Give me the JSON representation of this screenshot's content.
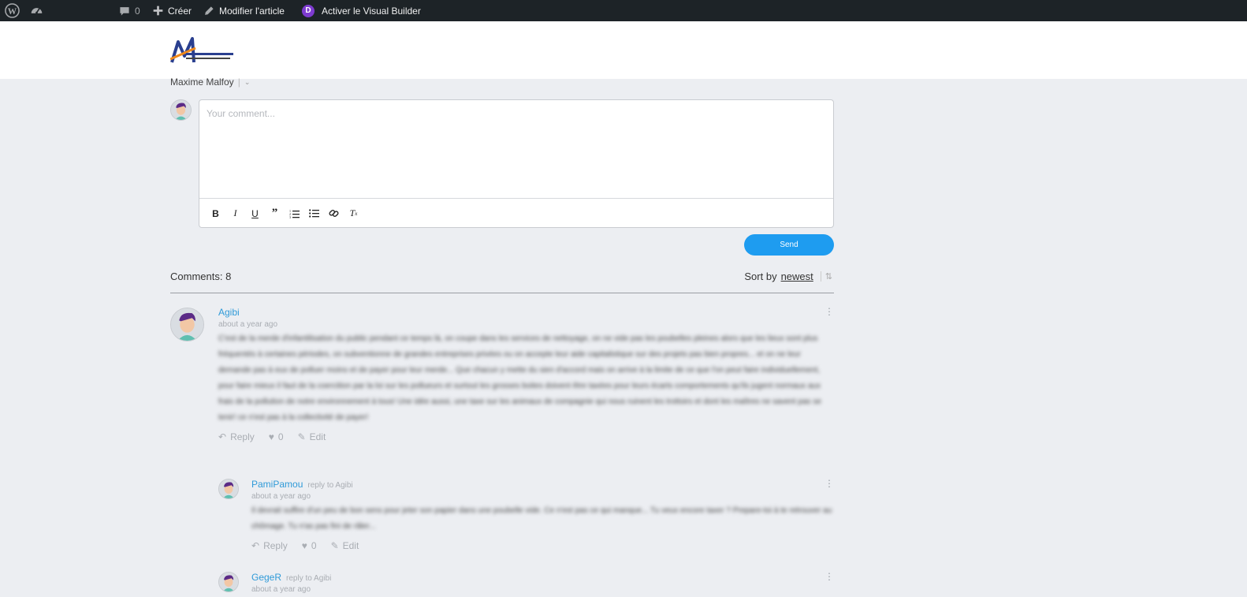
{
  "adminbar": {
    "wp_logo": "wordpress-icon",
    "dashboard_icon": "dashboard-icon",
    "comments_icon": "comment-bubble-icon",
    "comments_count": "0",
    "create_label": "Créer",
    "edit_label": "Modifier l'article",
    "divi_letter": "D",
    "visual_builder_label": "Activer le Visual Builder"
  },
  "header": {
    "logo_icon": "maxime-malfoy-logo"
  },
  "author": {
    "name": "Maxime Malfoy"
  },
  "editor": {
    "placeholder": "Your comment...",
    "toolbar": [
      "bold",
      "italic",
      "underline",
      "quote",
      "ordered-list",
      "bullet-list",
      "link",
      "clear-format"
    ],
    "send_label": "Send"
  },
  "comments_header": {
    "count_label": "Comments: 8",
    "sort_prefix": "Sort by",
    "sort_value": "newest"
  },
  "comments": [
    {
      "author": "Agibi",
      "reply_to": "",
      "date": "about a year ago",
      "text": "C'est de la merde d'infantilisation du public pendant ce temps là, on coupe dans les services de nettoyage, on ne vide pas les poubelles pleines alors que les lieux sont plus fréquentés à certaines périodes, on subventionne de grandes entreprises privées ou on accepte leur aide capitalistique sur des projets pas bien propres... et on ne leur demande pas à eux de polluer moins et de payer pour leur merde... Que chacun y mette du sien d'accord mais on arrive à la limite de ce que l'on peut faire individuellement, pour faire mieux il faut de la coercition par la loi sur les pollueurs et surtout les grosses boites doivent être taxées pour leurs écarts comportements qu'ils jugent normaux aux frais de la pollution de notre environnement à tous! Une idée aussi, une taxe sur les animaux de compagnie qui nous ruinent les trottoirs et dont les maîtres ne savent pas se tenir! ce n'est pas à la collectivité de payer!",
      "reply_label": "Reply",
      "likes": "0",
      "edit_label": "Edit"
    },
    {
      "author": "PamiPamou",
      "reply_to": "reply to Agibi",
      "date": "about a year ago",
      "text": "Il devrait suffire d'un peu de bon sens pour jeter son papier dans une poubelle vide. Ce n'est pas ce qui manque... Tu veux encore taxer ? Prepare-toi à te retrouver au chômage. Tu n'as pas fini de râler...",
      "reply_label": "Reply",
      "likes": "0",
      "edit_label": "Edit"
    },
    {
      "author": "GegeR",
      "reply_to": "reply to Agibi",
      "date": "about a year ago"
    }
  ]
}
